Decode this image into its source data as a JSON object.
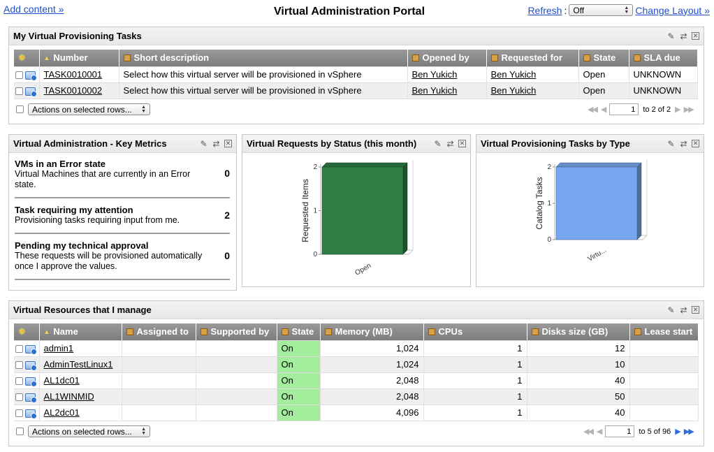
{
  "topbar": {
    "add_content": "Add content »",
    "title": "Virtual Administration Portal",
    "refresh_label": "Refresh",
    "refresh_value": "Off",
    "change_layout": "Change Layout »"
  },
  "tasks_panel": {
    "title": "My Virtual Provisioning Tasks",
    "columns": [
      "Number",
      "Short description",
      "Opened by",
      "Requested for",
      "State",
      "SLA due"
    ],
    "rows": [
      {
        "number": "TASK0010001",
        "description": "Select how this virtual server will be provisioned in vSphere",
        "opened_by": "Ben Yukich",
        "requested_for": "Ben Yukich",
        "state": "Open",
        "sla_due": "UNKNOWN"
      },
      {
        "number": "TASK0010002",
        "description": "Select how this virtual server will be provisioned in vSphere",
        "opened_by": "Ben Yukich",
        "requested_for": "Ben Yukich",
        "state": "Open",
        "sla_due": "UNKNOWN"
      }
    ],
    "actions_label": "Actions on selected rows...",
    "page_input": "1",
    "page_text": "to 2 of 2"
  },
  "metrics_panel": {
    "title": "Virtual Administration - Key Metrics",
    "items": [
      {
        "title": "VMs in an Error state",
        "desc": "Virtual Machines that are currently in an Error state.",
        "value": "0"
      },
      {
        "title": "Task requiring my attention",
        "desc": "Provisioning tasks requiring input from me.",
        "value": "2"
      },
      {
        "title": "Pending my technical approval",
        "desc": "These requests will be provisioned automatically once I approve the values.",
        "value": "0"
      }
    ]
  },
  "requests_chart_panel": {
    "title": "Virtual Requests by Status (this month)"
  },
  "tasks_chart_panel": {
    "title": "Virtual Provisioning Tasks by Type"
  },
  "chart_data": [
    {
      "type": "bar",
      "title": "Virtual Requests by Status (this month)",
      "categories": [
        "Open"
      ],
      "values": [
        2
      ],
      "ylabel": "Requested Items",
      "yticks": [
        "0",
        "1",
        "2"
      ],
      "ylim": [
        0,
        2
      ],
      "color": "#2e7d45"
    },
    {
      "type": "bar",
      "title": "Virtual Provisioning Tasks by Type",
      "categories": [
        "Virtu..."
      ],
      "values": [
        2
      ],
      "ylabel": "Catalog Tasks",
      "yticks": [
        "0",
        "1",
        "2"
      ],
      "ylim": [
        0,
        2
      ],
      "color": "#76a6ee"
    }
  ],
  "resources_panel": {
    "title": "Virtual Resources that I manage",
    "columns": [
      "Name",
      "Assigned to",
      "Supported by",
      "State",
      "Memory (MB)",
      "CPUs",
      "Disks size (GB)",
      "Lease start"
    ],
    "rows": [
      {
        "name": "admin1",
        "assigned_to": "",
        "supported_by": "",
        "state": "On",
        "memory": "1,024",
        "cpus": "1",
        "disks": "12",
        "lease_start": ""
      },
      {
        "name": "AdminTestLinux1",
        "assigned_to": "",
        "supported_by": "",
        "state": "On",
        "memory": "1,024",
        "cpus": "1",
        "disks": "10",
        "lease_start": ""
      },
      {
        "name": "AL1dc01",
        "assigned_to": "",
        "supported_by": "",
        "state": "On",
        "memory": "2,048",
        "cpus": "1",
        "disks": "40",
        "lease_start": ""
      },
      {
        "name": "AL1WINMID",
        "assigned_to": "",
        "supported_by": "",
        "state": "On",
        "memory": "2,048",
        "cpus": "1",
        "disks": "50",
        "lease_start": ""
      },
      {
        "name": "AL2dc01",
        "assigned_to": "",
        "supported_by": "",
        "state": "On",
        "memory": "4,096",
        "cpus": "1",
        "disks": "40",
        "lease_start": ""
      }
    ],
    "actions_label": "Actions on selected rows...",
    "page_input": "1",
    "page_text": "to 5 of 96"
  },
  "colors": {
    "link": "#1f4fc8",
    "state_on": "#a2ee9c",
    "header_gray": "#8a8a8a"
  },
  "icons": [
    "gear-icon",
    "sort-asc-icon",
    "column-icon",
    "edit-icon",
    "refresh-icon",
    "close-icon",
    "vm-info-icon",
    "pager-first-icon",
    "pager-prev-icon",
    "pager-next-icon",
    "pager-last-icon"
  ]
}
